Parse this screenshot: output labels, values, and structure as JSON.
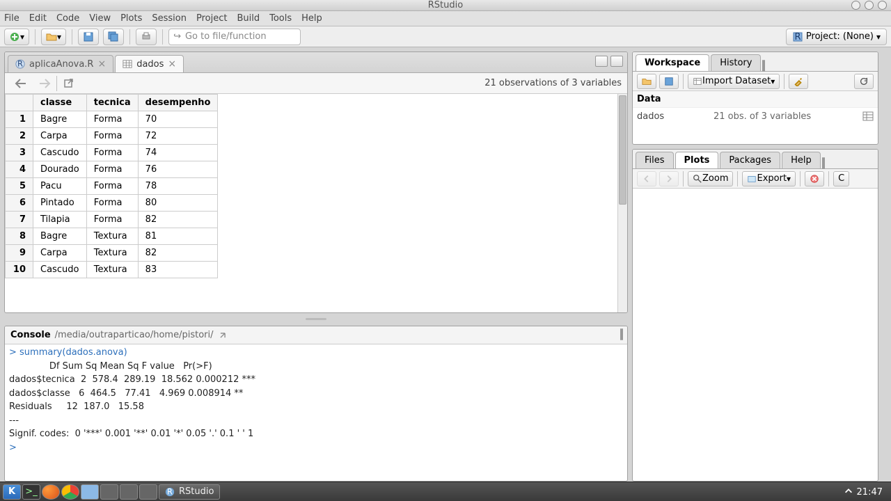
{
  "window": {
    "title": "RStudio"
  },
  "menu": [
    "File",
    "Edit",
    "Code",
    "View",
    "Plots",
    "Session",
    "Project",
    "Build",
    "Tools",
    "Help"
  ],
  "toolbar": {
    "goto_placeholder": "Go to file/function",
    "project_label": "Project: (None)"
  },
  "source": {
    "tabs": [
      {
        "label": "aplicaAnova.R",
        "active": false
      },
      {
        "label": "dados",
        "active": true
      }
    ],
    "info": "21 observations of 3 variables",
    "columns": [
      "",
      "classe",
      "tecnica",
      "desempenho"
    ],
    "rows": [
      [
        "1",
        "Bagre",
        "Forma",
        "70"
      ],
      [
        "2",
        "Carpa",
        "Forma",
        "72"
      ],
      [
        "3",
        "Cascudo",
        "Forma",
        "74"
      ],
      [
        "4",
        "Dourado",
        "Forma",
        "76"
      ],
      [
        "5",
        "Pacu",
        "Forma",
        "78"
      ],
      [
        "6",
        "Pintado",
        "Forma",
        "80"
      ],
      [
        "7",
        "Tilapia",
        "Forma",
        "82"
      ],
      [
        "8",
        "Bagre",
        "Textura",
        "81"
      ],
      [
        "9",
        "Carpa",
        "Textura",
        "82"
      ],
      [
        "10",
        "Cascudo",
        "Textura",
        "83"
      ]
    ]
  },
  "console": {
    "title": "Console",
    "path": "/media/outraparticao/home/pistori/",
    "lines": [
      "> summary(dados.anova)",
      "              Df Sum Sq Mean Sq F value   Pr(>F)",
      "dados$tecnica  2  578.4  289.19  18.562 0.000212 ***",
      "dados$classe   6  464.5   77.41   4.969 0.008914 **",
      "Residuals     12  187.0   15.58",
      "---",
      "Signif. codes:  0 '***' 0.001 '**' 0.01 '*' 0.05 '.' 0.1 ' ' 1",
      "> "
    ]
  },
  "workspace": {
    "tabs": [
      "Workspace",
      "History"
    ],
    "import_label": "Import Dataset",
    "section": "Data",
    "items": [
      {
        "name": "dados",
        "value": "21 obs. of 3 variables"
      }
    ]
  },
  "plots": {
    "tabs": [
      "Files",
      "Plots",
      "Packages",
      "Help"
    ],
    "zoom_label": "Zoom",
    "export_label": "Export",
    "clear_label": "C"
  },
  "taskbar": {
    "entry": "RStudio",
    "clock": "21:47"
  }
}
